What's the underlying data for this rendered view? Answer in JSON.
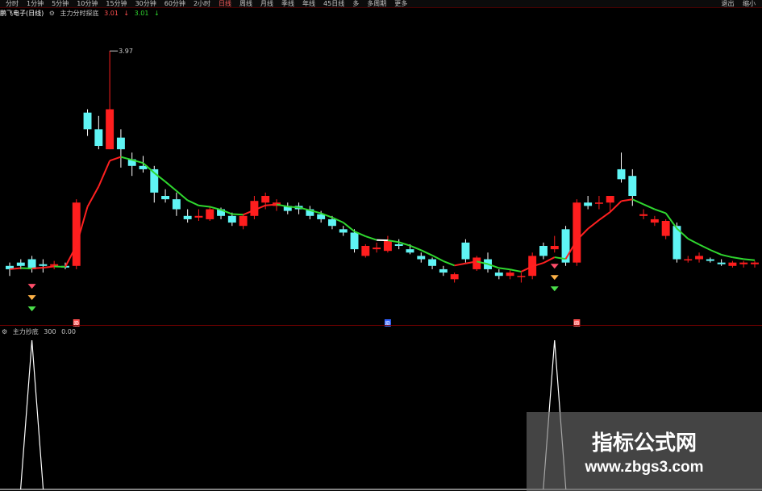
{
  "toolbar": {
    "periods": [
      "分时",
      "1分钟",
      "5分钟",
      "10分钟",
      "15分钟",
      "30分钟",
      "60分钟",
      "2小时",
      "日线",
      "周线",
      "月线",
      "季线",
      "年线",
      "45日线",
      "多",
      "多周期",
      "更多"
    ],
    "active_period": "日线",
    "right_buttons": [
      "退出",
      "缩小"
    ]
  },
  "indicator_bar": {
    "stock": "鹏飞电子(日线)",
    "formula": "主力分时探底",
    "value": "3.01",
    "value2": "3.01"
  },
  "sub_indicator": {
    "name": "主力抄底",
    "param": "300",
    "value": "0.00"
  },
  "chart_data": {
    "type": "candlestick",
    "annotation_high": "3.97",
    "ylim": [
      2.35,
      4.15
    ],
    "candles": [
      [
        2.68,
        2.7,
        2.62,
        2.66
      ],
      [
        2.7,
        2.72,
        2.66,
        2.68
      ],
      [
        2.72,
        2.74,
        2.64,
        2.66
      ],
      [
        2.69,
        2.72,
        2.64,
        2.68
      ],
      [
        2.68,
        2.71,
        2.66,
        2.69
      ],
      [
        2.68,
        2.7,
        2.66,
        2.67
      ],
      [
        2.68,
        3.08,
        2.66,
        3.06
      ],
      [
        3.6,
        3.62,
        3.46,
        3.5
      ],
      [
        3.5,
        3.58,
        3.38,
        3.4
      ],
      [
        3.38,
        3.97,
        3.38,
        3.62
      ],
      [
        3.45,
        3.5,
        3.27,
        3.38
      ],
      [
        3.32,
        3.36,
        3.22,
        3.28
      ],
      [
        3.28,
        3.34,
        3.24,
        3.26
      ],
      [
        3.26,
        3.28,
        3.06,
        3.12
      ],
      [
        3.1,
        3.14,
        3.06,
        3.08
      ],
      [
        3.08,
        3.12,
        2.98,
        3.02
      ],
      [
        2.98,
        3.02,
        2.94,
        2.96
      ],
      [
        2.97,
        3.02,
        2.95,
        2.98
      ],
      [
        2.96,
        3.04,
        2.95,
        3.02
      ],
      [
        3.02,
        3.03,
        2.96,
        2.98
      ],
      [
        2.98,
        3.0,
        2.92,
        2.94
      ],
      [
        2.92,
        2.99,
        2.9,
        2.98
      ],
      [
        2.98,
        3.1,
        2.96,
        3.07
      ],
      [
        3.06,
        3.12,
        3.02,
        3.1
      ],
      [
        3.04,
        3.08,
        3.01,
        3.06
      ],
      [
        3.04,
        3.06,
        2.99,
        3.01
      ],
      [
        3.04,
        3.06,
        2.99,
        3.02
      ],
      [
        3.02,
        3.04,
        2.96,
        2.98
      ],
      [
        2.99,
        3.01,
        2.94,
        2.96
      ],
      [
        2.96,
        2.98,
        2.9,
        2.92
      ],
      [
        2.9,
        2.92,
        2.86,
        2.88
      ],
      [
        2.88,
        2.9,
        2.76,
        2.78
      ],
      [
        2.74,
        2.81,
        2.73,
        2.8
      ],
      [
        2.78,
        2.82,
        2.76,
        2.79
      ],
      [
        2.77,
        2.86,
        2.76,
        2.83
      ],
      [
        2.81,
        2.84,
        2.78,
        2.8
      ],
      [
        2.78,
        2.81,
        2.75,
        2.76
      ],
      [
        2.74,
        2.76,
        2.7,
        2.72
      ],
      [
        2.72,
        2.73,
        2.66,
        2.68
      ],
      [
        2.66,
        2.68,
        2.62,
        2.64
      ],
      [
        2.6,
        2.64,
        2.58,
        2.63
      ],
      [
        2.82,
        2.84,
        2.7,
        2.72
      ],
      [
        2.66,
        2.74,
        2.65,
        2.73
      ],
      [
        2.72,
        2.76,
        2.64,
        2.66
      ],
      [
        2.64,
        2.66,
        2.6,
        2.62
      ],
      [
        2.62,
        2.66,
        2.6,
        2.64
      ],
      [
        2.62,
        2.64,
        2.58,
        2.62
      ],
      [
        2.62,
        2.76,
        2.6,
        2.74
      ],
      [
        2.8,
        2.82,
        2.72,
        2.74
      ],
      [
        2.78,
        2.86,
        2.76,
        2.8
      ],
      [
        2.9,
        2.92,
        2.68,
        2.7
      ],
      [
        2.7,
        3.08,
        2.68,
        3.06
      ],
      [
        3.06,
        3.1,
        3.02,
        3.04
      ],
      [
        3.06,
        3.1,
        3.02,
        3.06
      ],
      [
        3.06,
        3.1,
        3.0,
        3.1
      ],
      [
        3.26,
        3.36,
        3.18,
        3.2
      ],
      [
        3.22,
        3.26,
        3.04,
        3.1
      ],
      [
        2.98,
        3.02,
        2.96,
        2.99
      ],
      [
        2.94,
        2.98,
        2.92,
        2.96
      ],
      [
        2.86,
        2.96,
        2.84,
        2.95
      ],
      [
        2.92,
        2.94,
        2.7,
        2.72
      ],
      [
        2.72,
        2.74,
        2.7,
        2.72
      ],
      [
        2.72,
        2.76,
        2.7,
        2.74
      ],
      [
        2.72,
        2.73,
        2.7,
        2.71
      ],
      [
        2.7,
        2.72,
        2.68,
        2.69
      ],
      [
        2.68,
        2.71,
        2.67,
        2.7
      ],
      [
        2.69,
        2.71,
        2.67,
        2.7
      ],
      [
        2.69,
        2.71,
        2.67,
        2.7
      ]
    ],
    "signal_candles": [
      2,
      49
    ],
    "spike_candles": [
      2,
      49
    ],
    "bottom_markers": [
      {
        "candle": 6,
        "label": "吸"
      },
      {
        "candle": 34,
        "label": "吸"
      },
      {
        "candle": 51,
        "label": "吸"
      }
    ],
    "colors": {
      "up": "#ff1e1e",
      "down": "#5ff5f5",
      "line_up": "#ff2020",
      "line_down": "#2fd72f",
      "line_flat": "#ffffff"
    }
  }
}
